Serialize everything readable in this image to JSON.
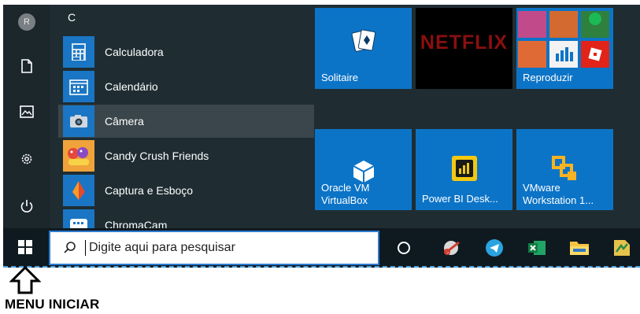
{
  "start_menu": {
    "section_letter": "C",
    "avatar_glyph": "R",
    "apps": [
      {
        "label": "Calculadora",
        "icon": "calculator-icon"
      },
      {
        "label": "Calendário",
        "icon": "calendar-icon"
      },
      {
        "label": "Câmera",
        "icon": "camera-icon",
        "selected": true
      },
      {
        "label": "Candy Crush Friends",
        "icon": "candy-crush-icon"
      },
      {
        "label": "Captura e Esboço",
        "icon": "snip-sketch-icon"
      },
      {
        "label": "ChromaCam",
        "icon": "chromacam-icon"
      }
    ],
    "tiles": [
      {
        "label": "Solitaire",
        "icon": "cards-icon"
      },
      {
        "label": "NETFLIX",
        "icon": "netflix-logo"
      },
      {
        "label": "Reproduzir",
        "icon": "games-folder-icon"
      },
      {
        "label_line1": "Oracle VM",
        "label_line2": "VirtualBox",
        "icon": "virtualbox-icon"
      },
      {
        "label": "Power BI Desk...",
        "icon": "powerbi-icon"
      },
      {
        "label_line1": "VMware",
        "label_line2": "Workstation 1...",
        "icon": "vmware-icon"
      }
    ],
    "rail_icons": [
      "avatar",
      "document-icon",
      "pictures-icon",
      "settings-icon",
      "power-icon"
    ]
  },
  "taskbar": {
    "search_placeholder": "Digite aqui para pesquisar",
    "items": [
      "cortana-icon",
      "snipping-tool-icon",
      "telegram-icon",
      "excel-icon",
      "file-explorer-icon",
      "app-icon"
    ]
  },
  "annotation": {
    "text": "MENU INICIAR"
  },
  "colors": {
    "tile_blue": "#0c74c7",
    "menu_bg": "#1f2d33",
    "taskbar_bg": "#0f1a20",
    "search_border": "#2d7ad1"
  }
}
